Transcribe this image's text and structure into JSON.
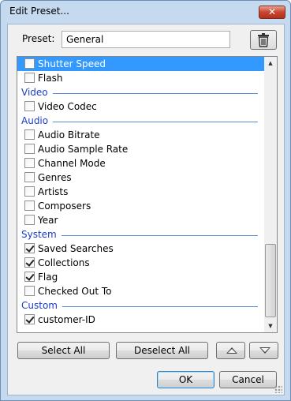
{
  "window": {
    "title": "Edit Preset...",
    "close_glyph": "✕"
  },
  "preset": {
    "label": "Preset:",
    "value": "General",
    "delete_icon": "trash-icon"
  },
  "list": {
    "rows": [
      {
        "type": "item",
        "label": "Shutter Speed",
        "checked": false,
        "selected": true
      },
      {
        "type": "item",
        "label": "Flash",
        "checked": false
      },
      {
        "type": "category",
        "label": "Video"
      },
      {
        "type": "item",
        "label": "Video Codec",
        "checked": false
      },
      {
        "type": "category",
        "label": "Audio"
      },
      {
        "type": "item",
        "label": "Audio Bitrate",
        "checked": false
      },
      {
        "type": "item",
        "label": "Audio Sample Rate",
        "checked": false
      },
      {
        "type": "item",
        "label": "Channel Mode",
        "checked": false
      },
      {
        "type": "item",
        "label": "Genres",
        "checked": false
      },
      {
        "type": "item",
        "label": "Artists",
        "checked": false
      },
      {
        "type": "item",
        "label": "Composers",
        "checked": false
      },
      {
        "type": "item",
        "label": "Year",
        "checked": false
      },
      {
        "type": "category",
        "label": "System"
      },
      {
        "type": "item",
        "label": "Saved Searches",
        "checked": true
      },
      {
        "type": "item",
        "label": "Collections",
        "checked": true
      },
      {
        "type": "item",
        "label": "Flag",
        "checked": true
      },
      {
        "type": "item",
        "label": "Checked Out To",
        "checked": false
      },
      {
        "type": "category",
        "label": "Custom"
      },
      {
        "type": "item",
        "label": "customer-ID",
        "checked": true
      }
    ]
  },
  "actions": {
    "select_all": "Select All",
    "deselect_all": "Deselect All",
    "move_up_icon": "triangle-up-icon",
    "move_down_icon": "triangle-down-icon"
  },
  "footer": {
    "ok": "OK",
    "cancel": "Cancel"
  },
  "colors": {
    "selection": "#3399ff",
    "category_text": "#1a3cc8",
    "category_line": "#5a8ad0"
  }
}
